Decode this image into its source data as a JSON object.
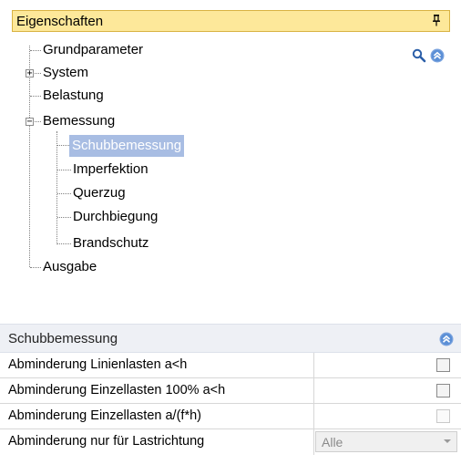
{
  "panel": {
    "title": "Eigenschaften",
    "pin_glyph": "➀"
  },
  "tree": {
    "items": [
      {
        "label": "Grundparameter"
      },
      {
        "label": "System",
        "expander": "+"
      },
      {
        "label": "Belastung"
      },
      {
        "label": "Bemessung",
        "expander": "−"
      },
      {
        "label": "Schubbemessung",
        "selected": true
      },
      {
        "label": "Imperfektion"
      },
      {
        "label": "Querzug"
      },
      {
        "label": "Durchbiegung"
      },
      {
        "label": "Brandschutz"
      },
      {
        "label": "Ausgabe"
      }
    ]
  },
  "icons": {
    "search": "search-icon",
    "collapse": "collapse-up-icon"
  },
  "grid": {
    "title": "Schubbemessung",
    "rows": [
      {
        "label": "Abminderung Linienlasten a<h",
        "type": "checkbox",
        "checked": false,
        "enabled": true
      },
      {
        "label": "Abminderung Einzellasten 100% a<h",
        "type": "checkbox",
        "checked": false,
        "enabled": true
      },
      {
        "label": "Abminderung Einzellasten a/(f*h)",
        "type": "checkbox",
        "checked": false,
        "enabled": false
      },
      {
        "label": "Abminderung nur für Lastrichtung",
        "type": "dropdown",
        "value": "Alle",
        "enabled": false
      }
    ]
  },
  "colors": {
    "header_bg": "#fde89a",
    "header_border": "#d9b343",
    "selection_bg": "#a8bde3",
    "accent_blue": "#5b8fd6"
  }
}
